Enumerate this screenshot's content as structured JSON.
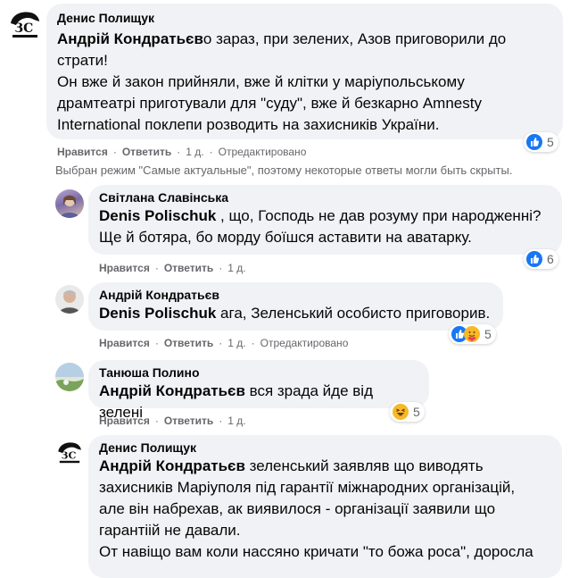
{
  "comments": [
    {
      "author": "Денис Полищук",
      "mention": "Андрій Кондратьєв",
      "text_lines": [
        "о зараз, при зелених, Азов приговорили до",
        "страти!",
        "Он вже й закон прийняли, вже й клітки у маріупольському",
        "драмтеатрі приготували для \"суду\", вже й безкарно Amnesty",
        "International поклепи розводить на захисників України."
      ],
      "like": "Нравится",
      "reply": "Ответить",
      "time": "1 д.",
      "edited": "Отредактировано",
      "reactions": "5"
    },
    {
      "author": "Світлана Славінська",
      "mention": "Denis Polischuk",
      "text_lines": [
        " , що, Господь не дав розуму при народженні?",
        "Ще й ботяра, бо морду боїшся аставити на аватарку."
      ],
      "like": "Нравится",
      "reply": "Ответить",
      "time": "1 д.",
      "reactions": "6"
    },
    {
      "author": "Андрій Кондратьєв",
      "mention": "Denis Polischuk",
      "text_lines": [
        " ага, Зеленський особисто приговорив."
      ],
      "like": "Нравится",
      "reply": "Ответить",
      "time": "1 д.",
      "edited": "Отредактировано",
      "reactions": "5"
    },
    {
      "author": "Танюша Полино",
      "mention": "Андрій Кондратьєв",
      "text_lines": [
        " вся зрада йде від зелені"
      ],
      "like": "Нравится",
      "reply": "Ответить",
      "time": "1 д.",
      "reactions": "5"
    },
    {
      "author": "Денис Полищук",
      "mention": "Андрій Кондратьєв",
      "text_lines": [
        " зеленський заявляв що виводять",
        "захисників Маріуполя під гарантії міжнародних організацій,",
        "але він набрехав, ак виявилося - організації заявили що",
        "гарантіій не давали.",
        "От навіщо вам коли нассяно кричати \"то божа роса\", доросла"
      ]
    }
  ],
  "notice": "Выбран режим \"Самые актуальные\", поэтому некоторые ответы могли быть скрыты.",
  "logo_text": "ЗС",
  "colors": {
    "like": "#1877f2",
    "haha": "#f7b928",
    "love": "#f33e58"
  }
}
